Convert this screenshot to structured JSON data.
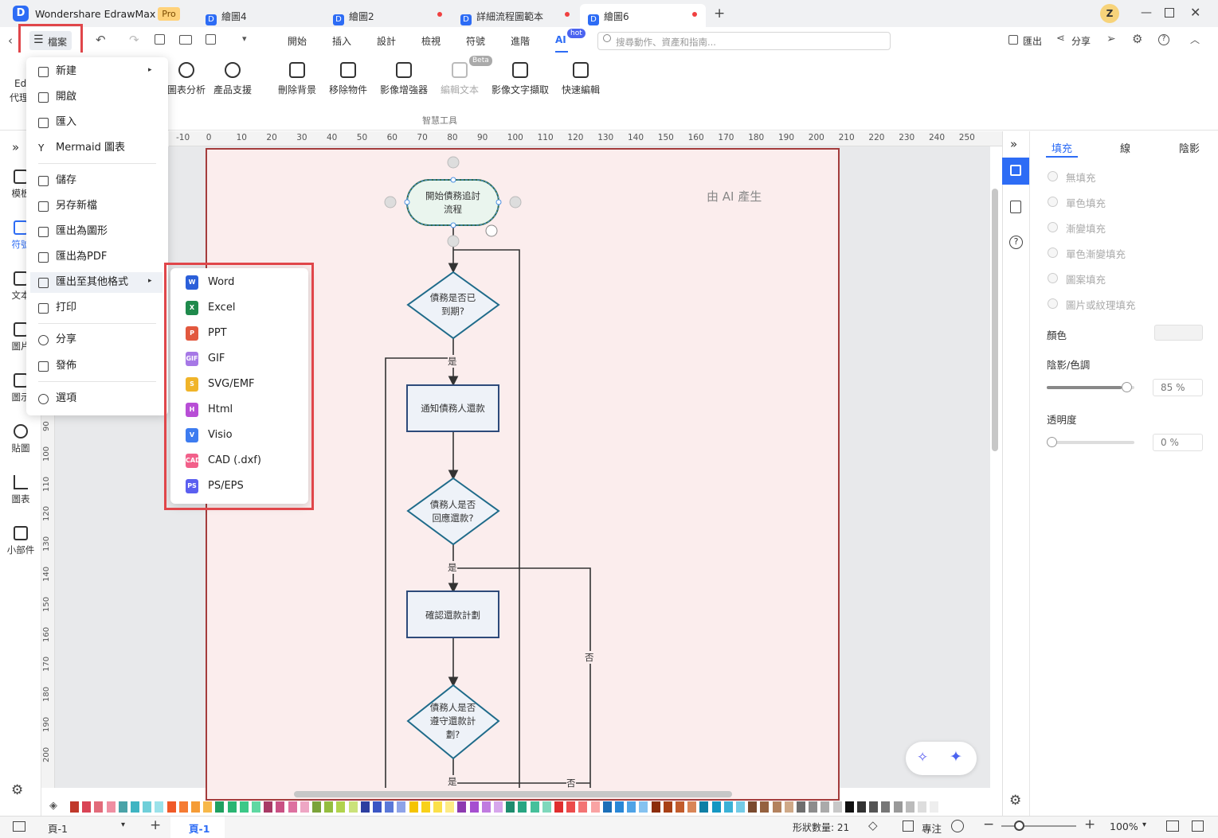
{
  "titlebar": {
    "app_name": "Wondershare EdrawMax",
    "pro_badge": "Pro",
    "tabs": [
      {
        "label": "繪圖4"
      },
      {
        "label": "繪圖2"
      },
      {
        "label": "詳細流程圖範本"
      },
      {
        "label": "繪圖6"
      }
    ],
    "user_initial": "Z"
  },
  "menubar": {
    "file": "檔案",
    "items": [
      "開始",
      "插入",
      "設計",
      "檢視",
      "符號",
      "進階",
      "AI"
    ],
    "ai_badge": "hot",
    "search_placeholder": "搜尋動作、資產和指南...",
    "export": "匯出",
    "share": "分享"
  },
  "ribbon": {
    "left_partial": "Ed",
    "left_partial2": "代理",
    "tools": [
      "圖表分析",
      "產品支援",
      "刪除背景",
      "移除物件",
      "影像增強器",
      "編輯文本",
      "影像文字擷取",
      "快速編輯"
    ],
    "beta": "Beta",
    "group_label": "智慧工具"
  },
  "left_toolbar": [
    "模板",
    "符號",
    "文本",
    "圖片",
    "圖示",
    "貼圖",
    "圖表",
    "小部件"
  ],
  "file_menu": {
    "items": [
      "新建",
      "開啟",
      "匯入",
      "Mermaid 圖表",
      "儲存",
      "另存新檔",
      "匯出為圖形",
      "匯出為PDF",
      "匯出至其他格式",
      "打印",
      "分享",
      "發佈",
      "選項"
    ]
  },
  "export_submenu": {
    "items": [
      {
        "label": "Word",
        "badge": "W",
        "color": "#2b5fd9"
      },
      {
        "label": "Excel",
        "badge": "X",
        "color": "#1f8a4c"
      },
      {
        "label": "PPT",
        "badge": "P",
        "color": "#e2583e"
      },
      {
        "label": "GIF",
        "badge": "GIF",
        "color": "#a678e6"
      },
      {
        "label": "SVG/EMF",
        "badge": "S",
        "color": "#f0b429"
      },
      {
        "label": "Html",
        "badge": "H",
        "color": "#b84ed6"
      },
      {
        "label": "Visio",
        "badge": "V",
        "color": "#3d7cf0"
      },
      {
        "label": "CAD (.dxf)",
        "badge": "CAD",
        "color": "#f2608a"
      },
      {
        "label": "PS/EPS",
        "badge": "PS",
        "color": "#5b5ff0"
      }
    ]
  },
  "ruler": {
    "h": [
      "-10",
      "0",
      "10",
      "20",
      "30",
      "40",
      "50",
      "60",
      "70",
      "80",
      "90",
      "100",
      "110",
      "120",
      "130",
      "140",
      "150",
      "160",
      "170",
      "180",
      "190",
      "200",
      "210",
      "220",
      "230",
      "240",
      "250"
    ],
    "v": [
      "90",
      "100",
      "110",
      "120",
      "130",
      "140",
      "150",
      "160",
      "170",
      "180",
      "190",
      "200"
    ]
  },
  "canvas": {
    "ai_label": "由 AI 產生",
    "nodes": {
      "start": [
        "開始債務追討",
        "流程"
      ],
      "d1": [
        "債務是否已",
        "到期?"
      ],
      "p1": "通知債務人還款",
      "d2": [
        "債務人是否",
        "回應還款?"
      ],
      "p2": "確認還款計劃",
      "d3": [
        "債務人是否",
        "遵守還款計",
        "劃?"
      ]
    },
    "edge_labels": {
      "yes": "是",
      "no": "否"
    }
  },
  "right_panel": {
    "tabs": [
      "填充",
      "線",
      "陰影"
    ],
    "fill_options": [
      "無填充",
      "單色填充",
      "漸變填充",
      "單色漸變填充",
      "圖案填充",
      "圖片或紋理填充"
    ],
    "color_label": "顏色",
    "shade_label": "陰影/色調",
    "shade_value": "85 %",
    "transparency_label": "透明度",
    "transparency_value": "0 %",
    "shade_level": 0.85,
    "transparency_level": 0.0
  },
  "statusbar": {
    "page_select": "頁-1",
    "active_page": "頁-1",
    "shape_count": "形狀數量: 21",
    "focus": "專注",
    "zoom": "100%"
  },
  "palette": [
    "#c0392b",
    "#d94455",
    "#e26b7a",
    "#ef8fa2",
    "#4aa3a8",
    "#3fb4c2",
    "#6fcfd9",
    "#9be2ea",
    "#f05a28",
    "#f57b33",
    "#f59c37",
    "#f7b84a",
    "#1fa060",
    "#2bb573",
    "#3cc888",
    "#5fd8a2",
    "#a83a65",
    "#c95184",
    "#dd71a0",
    "#eea6c4",
    "#7ba33a",
    "#94bd3f",
    "#b1d34d",
    "#cbe27a",
    "#2d3fa0",
    "#3b56c4",
    "#5a78d8",
    "#8ea3e8",
    "#f5c400",
    "#f8d11a",
    "#fbe049",
    "#fdeb85",
    "#8d3ab0",
    "#a64fd0",
    "#c07be0",
    "#d7a6ec",
    "#1e8c6e",
    "#28a582",
    "#46c09b",
    "#7fd8bc",
    "#e02e2e",
    "#ec4b4b",
    "#f37474",
    "#f9a3a3",
    "#1b6fb8",
    "#2987d6",
    "#4fa3e6",
    "#85c2f0",
    "#8c2d0a",
    "#a84015",
    "#c25c2c",
    "#d98657",
    "#0f7fa5",
    "#1597c2",
    "#3bb1d6",
    "#73cbe6",
    "#7a4a2e",
    "#95613f",
    "#b3825e",
    "#cfa988",
    "#6e6e6e",
    "#8c8c8c",
    "#aaaaaa",
    "#c8c8c8",
    "#111111",
    "#333333",
    "#555555",
    "#777777",
    "#999999",
    "#bbbbbb",
    "#dddddd",
    "#eeeeee"
  ]
}
